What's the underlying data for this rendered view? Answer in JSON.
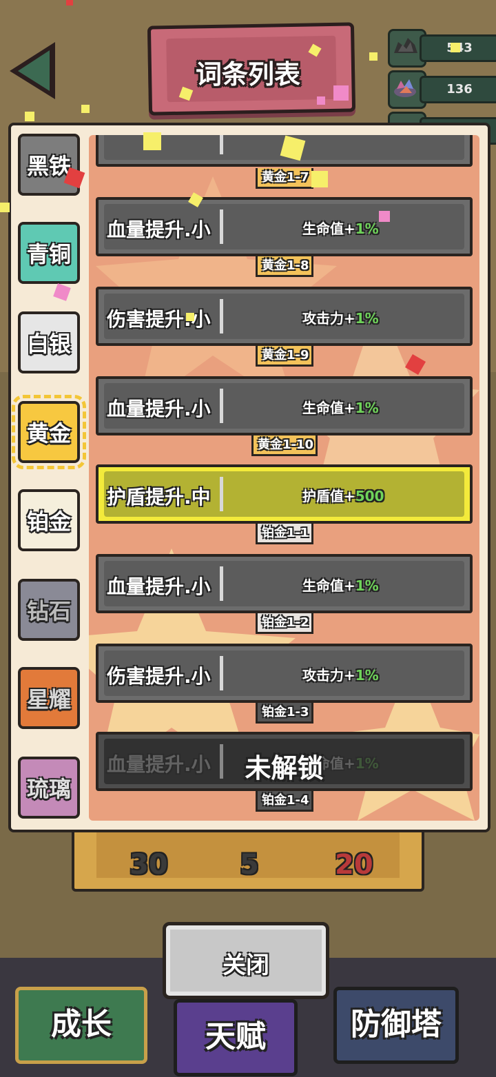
{
  "title": "词条列表",
  "resources": [
    {
      "icon": "coal-icon",
      "value": "543"
    },
    {
      "icon": "crystal-ore-icon",
      "value": "136"
    }
  ],
  "tabs": [
    {
      "label": "黑铁",
      "color": "#7d7d7d",
      "selected": false
    },
    {
      "label": "青铜",
      "color": "#5fc9b3",
      "selected": false
    },
    {
      "label": "白银",
      "color": "#e6e6e6",
      "selected": false
    },
    {
      "label": "黄金",
      "color": "#f7c840",
      "selected": true
    },
    {
      "label": "铂金",
      "color": "#f5efdc",
      "selected": false
    },
    {
      "label": "钻石",
      "color": "#8a8a96",
      "selected": false
    },
    {
      "label": "星耀",
      "color": "#e27a3a",
      "selected": false
    },
    {
      "label": "琉璃",
      "color": "#c48ab8",
      "selected": false
    }
  ],
  "rows": [
    {
      "name": "血量提升.小",
      "effect_label": "生命值+",
      "effect_value": "1%",
      "state": "normal"
    },
    {
      "name": "伤害提升.小",
      "effect_label": "攻击力+",
      "effect_value": "1%",
      "state": "normal"
    },
    {
      "name": "血量提升.小",
      "effect_label": "生命值+",
      "effect_value": "1%",
      "state": "normal"
    },
    {
      "name": "护盾提升.中",
      "effect_label": "护盾值+",
      "effect_value": "500",
      "state": "active"
    },
    {
      "name": "血量提升.小",
      "effect_label": "生命值+",
      "effect_value": "1%",
      "state": "normal"
    },
    {
      "name": "伤害提升.小",
      "effect_label": "攻击力+",
      "effect_value": "1%",
      "state": "normal"
    },
    {
      "name": "血量提升.小",
      "effect_label": "生命值+",
      "effect_value": "1%",
      "state": "locked"
    }
  ],
  "tags": [
    {
      "label": "黄金1-7",
      "style": "gold"
    },
    {
      "label": "黄金1-8",
      "style": "gold"
    },
    {
      "label": "黄金1-9",
      "style": "gold"
    },
    {
      "label": "黄金1-10",
      "style": "gold"
    },
    {
      "label": "铂金1-1",
      "style": "plat"
    },
    {
      "label": "铂金1-2",
      "style": "plat"
    },
    {
      "label": "铂金1-3",
      "style": "dark"
    },
    {
      "label": "铂金1-4",
      "style": "dark"
    }
  ],
  "locked_label": "未解锁",
  "under_panel": {
    "values": [
      "30",
      "5",
      "20"
    ],
    "highlight_color": "#b83a3a"
  },
  "close_label": "关闭",
  "nav": [
    {
      "label": "成长",
      "color": "#3e7a50",
      "border": "#c8a04a"
    },
    {
      "label": "天赋",
      "color": "#5a3f8e",
      "border": "#1e1e1e"
    },
    {
      "label": "防御塔",
      "color": "#3d4a6a",
      "border": "#1e1e1e"
    }
  ]
}
